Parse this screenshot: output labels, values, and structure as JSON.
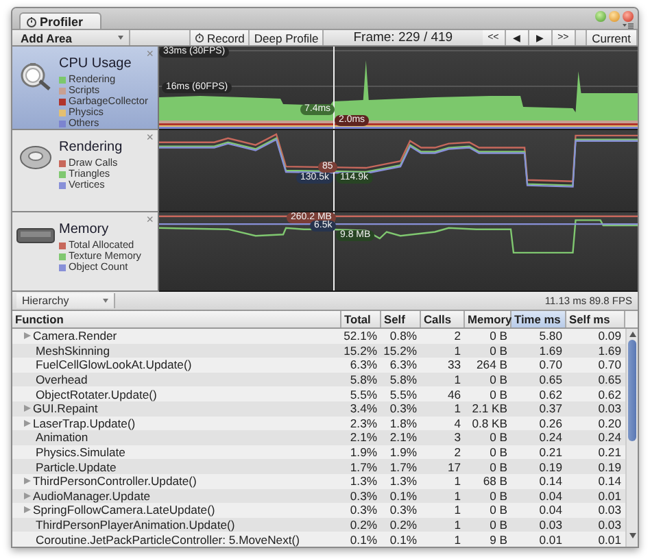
{
  "window": {
    "tab": "Profiler"
  },
  "toolbar": {
    "add_area": "Add Area",
    "record": "Record",
    "deep_profile": "Deep Profile",
    "frame": "Frame: 229 / 419",
    "nav": [
      "<<",
      "◀",
      "▶",
      ">>"
    ],
    "current": "Current"
  },
  "areas": [
    {
      "kind": "cpu",
      "title": "CPU Usage",
      "selected": true,
      "close": "×",
      "legend": [
        {
          "label": "Rendering",
          "color": "#7cc86c"
        },
        {
          "label": "Scripts",
          "color": "#c8a092"
        },
        {
          "label": "GarbageCollector",
          "color": "#b0342c"
        },
        {
          "label": "Physics",
          "color": "#e4c070"
        },
        {
          "label": "Others",
          "color": "#7c84d0"
        }
      ],
      "markers": [
        {
          "text": "33ms (30FPS)",
          "color": "#262626"
        },
        {
          "text": "16ms (60FPS)",
          "color": "#262626"
        },
        {
          "text": "7.4ms",
          "color": "#3f6e34"
        },
        {
          "text": "2.0ms",
          "color": "#5e2420"
        }
      ]
    },
    {
      "kind": "rendering",
      "title": "Rendering",
      "selected": false,
      "close": "×",
      "legend": [
        {
          "label": "Draw Calls",
          "color": "#c8685c"
        },
        {
          "label": "Triangles",
          "color": "#80c870"
        },
        {
          "label": "Vertices",
          "color": "#8890d8"
        }
      ],
      "markers": [
        {
          "text": "85",
          "color": "#7a3e36"
        },
        {
          "text": "130.5k",
          "color": "#27344e"
        },
        {
          "text": "114.9k",
          "color": "#284424"
        }
      ]
    },
    {
      "kind": "memory",
      "title": "Memory",
      "selected": false,
      "close": "×",
      "legend": [
        {
          "label": "Total Allocated",
          "color": "#c8685c"
        },
        {
          "label": "Texture Memory",
          "color": "#80c870"
        },
        {
          "label": "Object Count",
          "color": "#8890d8"
        }
      ],
      "markers": [
        {
          "text": "260.2 MB",
          "color": "#7a3e36"
        },
        {
          "text": "6.5k",
          "color": "#27344e"
        },
        {
          "text": "9.8 MB",
          "color": "#284424"
        }
      ]
    }
  ],
  "view": {
    "mode": "Hierarchy",
    "stats": "11.13 ms 89.8 FPS"
  },
  "table": {
    "columns": [
      {
        "label": "Function",
        "selected": false
      },
      {
        "label": "Total",
        "selected": false
      },
      {
        "label": "Self",
        "selected": false
      },
      {
        "label": "Calls",
        "selected": false
      },
      {
        "label": "Memory",
        "selected": false
      },
      {
        "label": "Time ms",
        "selected": true
      },
      {
        "label": "Self ms",
        "selected": false
      }
    ],
    "rows": [
      {
        "kind": "node",
        "cells": [
          "Camera.Render",
          "52.1%",
          "0.8%",
          "2",
          "0 B",
          "5.80",
          "0.09"
        ]
      },
      {
        "kind": "leaf",
        "cells": [
          "MeshSkinning",
          "15.2%",
          "15.2%",
          "1",
          "0 B",
          "1.69",
          "1.69"
        ]
      },
      {
        "kind": "leaf",
        "cells": [
          "FuelCellGlowLookAt.Update()",
          "6.3%",
          "6.3%",
          "33",
          "264 B",
          "0.70",
          "0.70"
        ]
      },
      {
        "kind": "leaf",
        "cells": [
          "Overhead",
          "5.8%",
          "5.8%",
          "1",
          "0 B",
          "0.65",
          "0.65"
        ]
      },
      {
        "kind": "leaf",
        "cells": [
          "ObjectRotater.Update()",
          "5.5%",
          "5.5%",
          "46",
          "0 B",
          "0.62",
          "0.62"
        ]
      },
      {
        "kind": "node",
        "cells": [
          "GUI.Repaint",
          "3.4%",
          "0.3%",
          "1",
          "2.1 KB",
          "0.37",
          "0.03"
        ]
      },
      {
        "kind": "node",
        "cells": [
          "LaserTrap.Update()",
          "2.3%",
          "1.8%",
          "4",
          "0.8 KB",
          "0.26",
          "0.20"
        ]
      },
      {
        "kind": "leaf",
        "cells": [
          "Animation",
          "2.1%",
          "2.1%",
          "3",
          "0 B",
          "0.24",
          "0.24"
        ]
      },
      {
        "kind": "leaf",
        "cells": [
          "Physics.Simulate",
          "1.9%",
          "1.9%",
          "2",
          "0 B",
          "0.21",
          "0.21"
        ]
      },
      {
        "kind": "leaf",
        "cells": [
          "Particle.Update",
          "1.7%",
          "1.7%",
          "17",
          "0 B",
          "0.19",
          "0.19"
        ]
      },
      {
        "kind": "node",
        "cells": [
          "ThirdPersonController.Update()",
          "1.3%",
          "1.3%",
          "1",
          "68 B",
          "0.14",
          "0.14"
        ]
      },
      {
        "kind": "node",
        "cells": [
          "AudioManager.Update",
          "0.3%",
          "0.1%",
          "1",
          "0 B",
          "0.04",
          "0.01"
        ]
      },
      {
        "kind": "node",
        "cells": [
          "SpringFollowCamera.LateUpdate()",
          "0.3%",
          "0.3%",
          "1",
          "0 B",
          "0.04",
          "0.03"
        ]
      },
      {
        "kind": "leaf",
        "cells": [
          "ThirdPersonPlayerAnimation.Update()",
          "0.2%",
          "0.2%",
          "1",
          "0 B",
          "0.03",
          "0.03"
        ]
      },
      {
        "kind": "leaf",
        "cells": [
          "Coroutine.JetPackParticleController: 5.MoveNext()",
          "0.1%",
          "0.1%",
          "1",
          "9 B",
          "0.01",
          "0.01"
        ]
      }
    ]
  }
}
